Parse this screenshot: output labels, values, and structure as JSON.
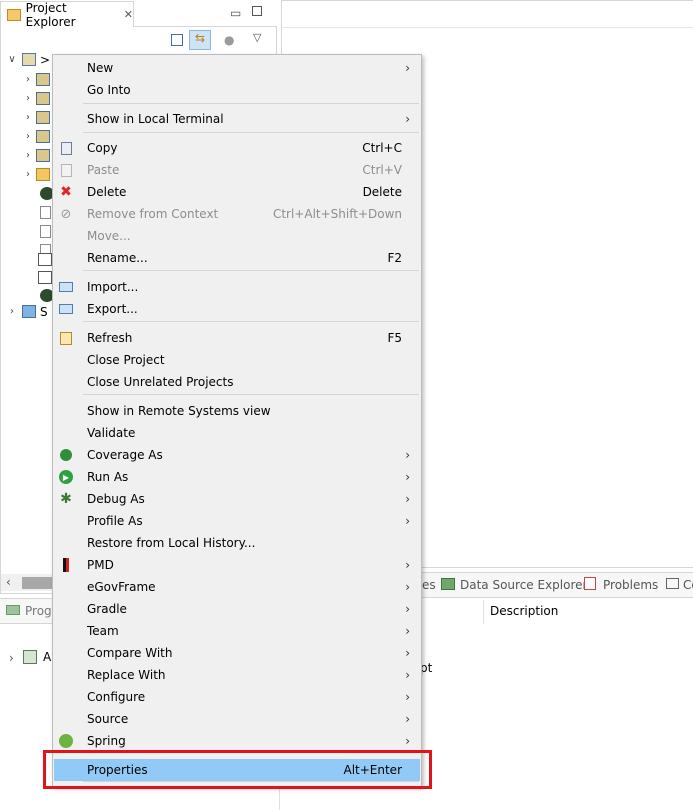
{
  "project_explorer": {
    "tab_title": "Project Explorer",
    "tree_root_text": ">",
    "partial_item_text": "S"
  },
  "bottom_left": {
    "tab_title": "Progr",
    "item_text": "A"
  },
  "bottom_tabs": {
    "partial_tab": "es",
    "data_source_explorer": "Data Source Explorer",
    "problems": "Problems",
    "console_partial": "Co"
  },
  "table": {
    "description_header": "Description",
    "partial_text": "pt"
  },
  "context_menu": {
    "items": [
      {
        "label": "New",
        "submenu": true
      },
      {
        "label": "Go Into"
      },
      {
        "label": "Show in Local Terminal",
        "submenu": true
      },
      {
        "label": "Copy",
        "shortcut": "Ctrl+C",
        "icon": "copy-icon"
      },
      {
        "label": "Paste",
        "shortcut": "Ctrl+V",
        "disabled": true,
        "icon": "paste-icon"
      },
      {
        "label": "Delete",
        "shortcut": "Delete",
        "icon": "delete-icon"
      },
      {
        "label": "Remove from Context",
        "shortcut": "Ctrl+Alt+Shift+Down",
        "disabled": true,
        "icon": "remove-context-icon"
      },
      {
        "label": "Move...",
        "disabled": true
      },
      {
        "label": "Rename...",
        "shortcut": "F2"
      },
      {
        "label": "Import...",
        "icon": "import-icon"
      },
      {
        "label": "Export...",
        "icon": "export-icon"
      },
      {
        "label": "Refresh",
        "shortcut": "F5",
        "icon": "refresh-icon"
      },
      {
        "label": "Close Project"
      },
      {
        "label": "Close Unrelated Projects"
      },
      {
        "label": "Show in Remote Systems view"
      },
      {
        "label": "Validate"
      },
      {
        "label": "Coverage As",
        "submenu": true,
        "icon": "coverage-icon"
      },
      {
        "label": "Run As",
        "submenu": true,
        "icon": "run-icon"
      },
      {
        "label": "Debug As",
        "submenu": true,
        "icon": "debug-icon"
      },
      {
        "label": "Profile As",
        "submenu": true
      },
      {
        "label": "Restore from Local History..."
      },
      {
        "label": "PMD",
        "submenu": true,
        "icon": "pmd-icon"
      },
      {
        "label": "eGovFrame",
        "submenu": true
      },
      {
        "label": "Gradle",
        "submenu": true
      },
      {
        "label": "Team",
        "submenu": true
      },
      {
        "label": "Compare With",
        "submenu": true
      },
      {
        "label": "Replace With",
        "submenu": true
      },
      {
        "label": "Configure",
        "submenu": true
      },
      {
        "label": "Source",
        "submenu": true
      },
      {
        "label": "Spring",
        "submenu": true,
        "icon": "spring-icon"
      },
      {
        "label": "Properties",
        "shortcut": "Alt+Enter",
        "selected": true
      }
    ]
  },
  "colors": {
    "selection": "#91c9f7",
    "highlight_box": "#e0141a",
    "menu_bg": "#f0f0f0"
  }
}
